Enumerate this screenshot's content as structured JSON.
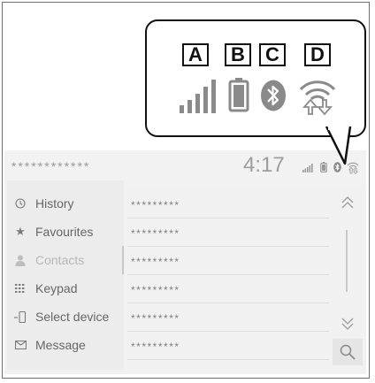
{
  "callout": {
    "labels": [
      "A",
      "B",
      "C",
      "D"
    ],
    "icons": [
      "signal-strength-icon",
      "battery-icon",
      "bluetooth-icon",
      "wifi-data-icon"
    ]
  },
  "header": {
    "title_masked": "************",
    "time": "4:17",
    "status_icons": [
      "signal-strength-icon",
      "battery-icon",
      "bluetooth-icon",
      "wifi-data-icon"
    ]
  },
  "sidebar": {
    "items": [
      {
        "label": "History",
        "icon": "clock-icon"
      },
      {
        "label": "Favourites",
        "icon": "star-icon"
      },
      {
        "label": "Contacts",
        "icon": "person-icon",
        "active": true
      },
      {
        "label": "Keypad",
        "icon": "keypad-icon"
      },
      {
        "label": "Select device",
        "icon": "phone-device-icon"
      },
      {
        "label": "Message",
        "icon": "envelope-icon"
      }
    ]
  },
  "list": {
    "rows": [
      "*********",
      "*********",
      "*********",
      "*********",
      "*********",
      "*********"
    ]
  },
  "scroll": {
    "up_icon": "double-chevron-up-icon",
    "down_icon": "double-chevron-down-icon",
    "search_icon": "search-icon"
  },
  "colors": {
    "screen_bg": "#f1f1f1",
    "text_gray": "#666666",
    "active_text": "#b7b7b7",
    "border": "#111111"
  }
}
